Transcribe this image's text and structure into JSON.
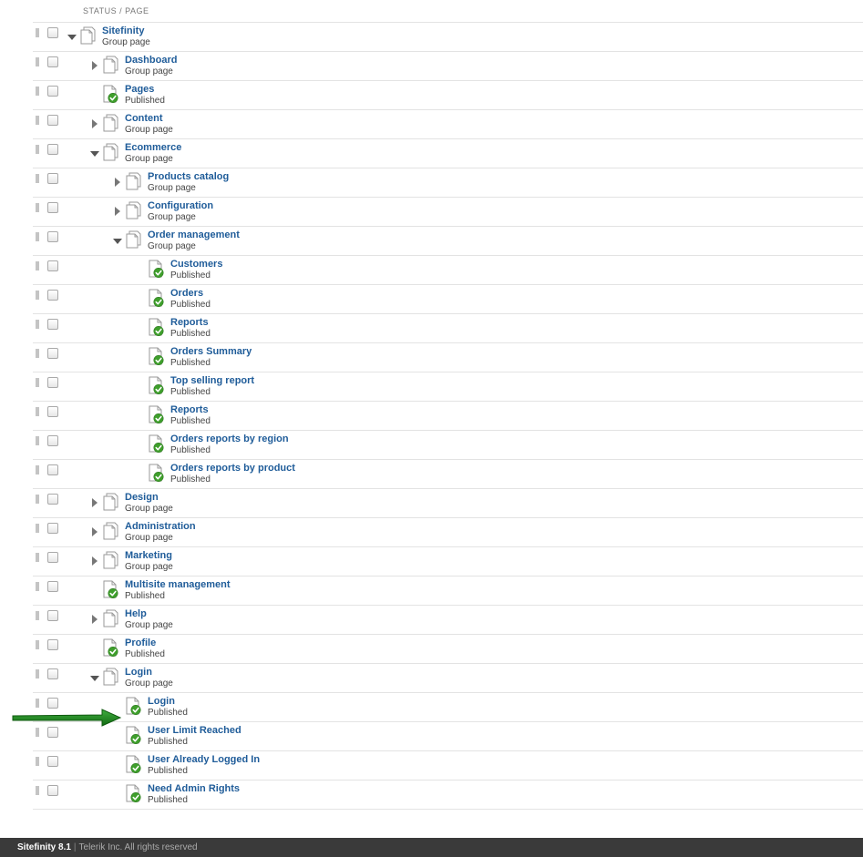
{
  "header": {
    "column_label": "STATUS / PAGE"
  },
  "colors": {
    "link": "#1f5c99",
    "published_check": "#3f9f2c",
    "footer_bg": "#3a3a3a",
    "arrow": "#1e8a1e"
  },
  "pages": [
    {
      "level": 0,
      "title": "Sitefinity",
      "status": "Group page",
      "type": "group",
      "toggle": "expanded"
    },
    {
      "level": 1,
      "title": "Dashboard",
      "status": "Group page",
      "type": "group",
      "toggle": "collapsed"
    },
    {
      "level": 1,
      "title": "Pages",
      "status": "Published",
      "type": "published",
      "toggle": "none"
    },
    {
      "level": 1,
      "title": "Content",
      "status": "Group page",
      "type": "group",
      "toggle": "collapsed"
    },
    {
      "level": 1,
      "title": "Ecommerce",
      "status": "Group page",
      "type": "group",
      "toggle": "expanded"
    },
    {
      "level": 2,
      "title": "Products catalog",
      "status": "Group page",
      "type": "group",
      "toggle": "collapsed"
    },
    {
      "level": 2,
      "title": "Configuration",
      "status": "Group page",
      "type": "group",
      "toggle": "collapsed"
    },
    {
      "level": 2,
      "title": "Order management",
      "status": "Group page",
      "type": "group",
      "toggle": "expanded"
    },
    {
      "level": 3,
      "title": "Customers",
      "status": "Published",
      "type": "published",
      "toggle": "none"
    },
    {
      "level": 3,
      "title": "Orders",
      "status": "Published",
      "type": "published",
      "toggle": "none"
    },
    {
      "level": 3,
      "title": "Reports",
      "status": "Published",
      "type": "published",
      "toggle": "none"
    },
    {
      "level": 3,
      "title": "Orders Summary",
      "status": "Published",
      "type": "published",
      "toggle": "none"
    },
    {
      "level": 3,
      "title": "Top selling report",
      "status": "Published",
      "type": "published",
      "toggle": "none"
    },
    {
      "level": 3,
      "title": "Reports",
      "status": "Published",
      "type": "published",
      "toggle": "none"
    },
    {
      "level": 3,
      "title": "Orders reports by region",
      "status": "Published",
      "type": "published",
      "toggle": "none"
    },
    {
      "level": 3,
      "title": "Orders reports by product",
      "status": "Published",
      "type": "published",
      "toggle": "none"
    },
    {
      "level": 1,
      "title": "Design",
      "status": "Group page",
      "type": "group",
      "toggle": "collapsed"
    },
    {
      "level": 1,
      "title": "Administration",
      "status": "Group page",
      "type": "group",
      "toggle": "collapsed"
    },
    {
      "level": 1,
      "title": "Marketing",
      "status": "Group page",
      "type": "group",
      "toggle": "collapsed"
    },
    {
      "level": 1,
      "title": "Multisite management",
      "status": "Published",
      "type": "published",
      "toggle": "none"
    },
    {
      "level": 1,
      "title": "Help",
      "status": "Group page",
      "type": "group",
      "toggle": "collapsed"
    },
    {
      "level": 1,
      "title": "Profile",
      "status": "Published",
      "type": "published",
      "toggle": "none"
    },
    {
      "level": 1,
      "title": "Login",
      "status": "Group page",
      "type": "group",
      "toggle": "expanded"
    },
    {
      "level": 2,
      "title": "Login",
      "status": "Published",
      "type": "published",
      "toggle": "none",
      "highlighted": true
    },
    {
      "level": 2,
      "title": "User Limit Reached",
      "status": "Published",
      "type": "published",
      "toggle": "none"
    },
    {
      "level": 2,
      "title": "User Already Logged In",
      "status": "Published",
      "type": "published",
      "toggle": "none"
    },
    {
      "level": 2,
      "title": "Need Admin Rights",
      "status": "Published",
      "type": "published",
      "toggle": "none"
    }
  ],
  "footer": {
    "product": "Sitefinity 8.1",
    "separator": "|",
    "copyright": "Telerik Inc. All rights reserved"
  }
}
